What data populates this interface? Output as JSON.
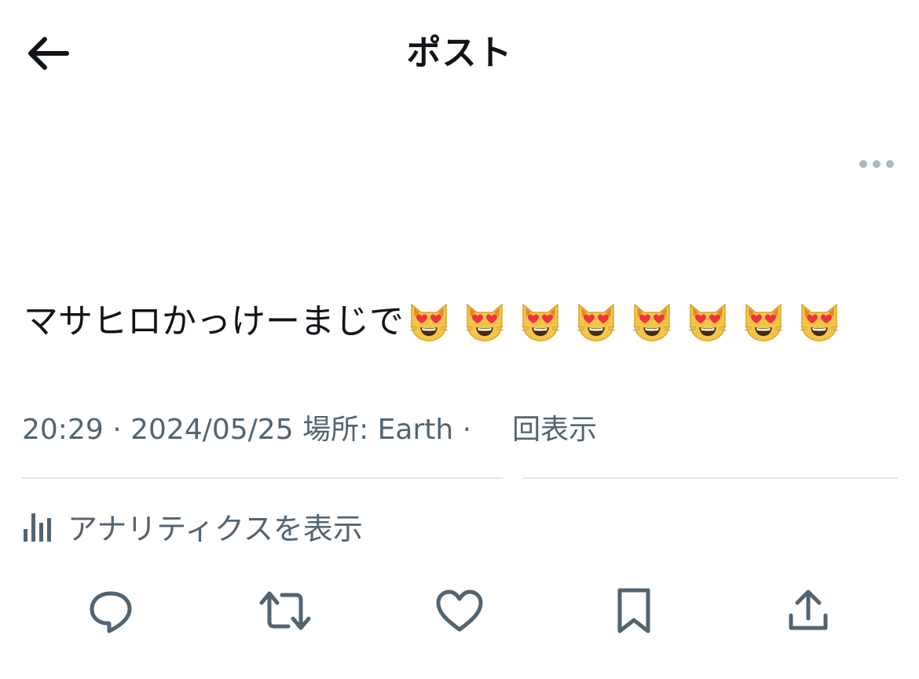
{
  "header": {
    "title": "ポスト",
    "back_icon": "arrow-left-icon"
  },
  "more_icon": "more-horizontal-icon",
  "tweet": {
    "text": "マサヒロかっけーまじで",
    "emoji": [
      "😻",
      "😻",
      "😻",
      "😻",
      "😻",
      "😻",
      "😻",
      "😻"
    ],
    "emoji_name": "smiling-cat-heart-eyes-emoji"
  },
  "meta": {
    "time": "20:29",
    "separator": "·",
    "date": "2024/05/25",
    "location_label": "場所: Earth",
    "views_label": "回表示"
  },
  "analytics": {
    "label": "アナリティクスを表示",
    "icon": "bar-chart-icon"
  },
  "actions": [
    {
      "name": "reply",
      "icon": "reply-icon"
    },
    {
      "name": "retweet",
      "icon": "retweet-icon"
    },
    {
      "name": "like",
      "icon": "heart-icon"
    },
    {
      "name": "bookmark",
      "icon": "bookmark-icon"
    },
    {
      "name": "share",
      "icon": "share-icon"
    }
  ],
  "colors": {
    "text_primary": "#0f1419",
    "text_secondary": "#536471",
    "divider": "#e4e8eb",
    "more_dots": "#aab8c2"
  }
}
